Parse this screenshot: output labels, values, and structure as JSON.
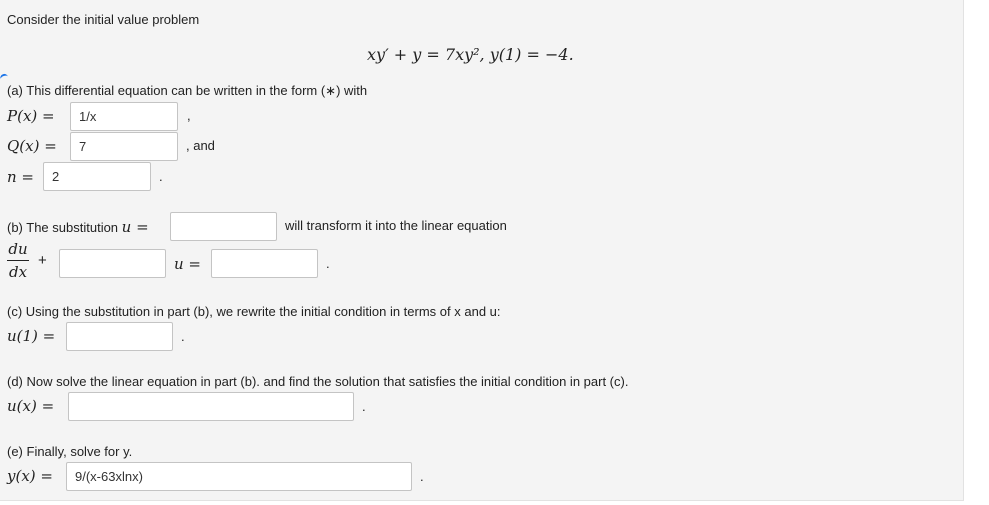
{
  "intro": "Consider the initial value problem",
  "equation": "xy′ + y = 7xy²,   y(1) = −4.",
  "part_a": {
    "text": "(a) This differential equation can be written in the form (∗) with",
    "p_label": "P(x) =",
    "p_value": "1/x",
    "q_label": "Q(x) =",
    "q_value": "7",
    "n_label": "n =",
    "n_value": "2",
    "comma": ",",
    "and": ", and",
    "period": "."
  },
  "part_b": {
    "text_before": "(b) The substitution ",
    "u_eq": "u =",
    "text_after": "will transform it into the linear equation",
    "du": "du",
    "dx": "dx",
    "plus": "+",
    "u_eq2": "u =",
    "substitution_value": "",
    "coef_value": "",
    "rhs_value": "",
    "period": "."
  },
  "part_c": {
    "text": "(c) Using the substitution in part (b), we rewrite the initial condition in terms of x and u:",
    "label": "u(1) =",
    "value": "",
    "period": "."
  },
  "part_d": {
    "text": "(d) Now solve the linear equation in part (b). and find the solution that satisfies the initial condition in part (c).",
    "label": "u(x) =",
    "value": "",
    "period": "."
  },
  "part_e": {
    "text": "(e) Finally, solve for y.",
    "label": "y(x) =",
    "value": "9/(x-63xlnx)",
    "period": "."
  }
}
